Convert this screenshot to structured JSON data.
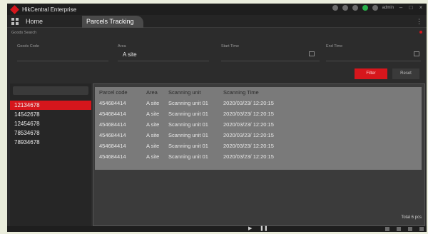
{
  "app": {
    "title": "HikCentral Enterprise",
    "user": "admin"
  },
  "tabs": {
    "home": "Home",
    "active": "Parcels Tracking"
  },
  "search": {
    "section_label": "Goods Search",
    "goods_code_label": "Goods Code",
    "area_label": "Area",
    "area_value": "A site",
    "start_time_label": "Start Time",
    "end_time_label": "End Time",
    "filter_button": "Filter",
    "reset_button": "Reset"
  },
  "list": {
    "items": [
      "12134678",
      "14542678",
      "12454678",
      "78534678",
      "78934678"
    ],
    "selected_index": 0
  },
  "table": {
    "headers": [
      "Parcel code",
      "Area",
      "Scanning unit",
      "Scanning Time"
    ],
    "rows": [
      [
        "454684414",
        "A site",
        "Scanning unit 01",
        "2020/03/23/ 12:20:15"
      ],
      [
        "454684414",
        "A site",
        "Scanning unit 01",
        "2020/03/23/ 12:20:15"
      ],
      [
        "454684414",
        "A site",
        "Scanning unit 01",
        "2020/03/23/ 12:20:15"
      ],
      [
        "454684414",
        "A site",
        "Scanning unit 01",
        "2020/03/23/ 12:20:15"
      ],
      [
        "454684414",
        "A site",
        "Scanning unit 01",
        "2020/03/23/ 12:20:15"
      ],
      [
        "454684414",
        "A site",
        "Scanning unit 01",
        "2020/03/23/ 12:20:15"
      ]
    ],
    "total": "Total 6 pcs"
  },
  "colors": {
    "accent": "#d6161c",
    "background": "#2c2c2c"
  }
}
